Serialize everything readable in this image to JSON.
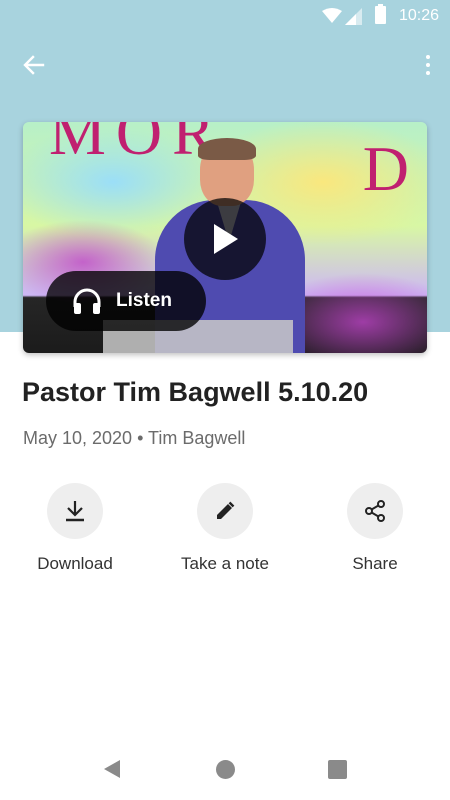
{
  "status_bar": {
    "time": "10:26",
    "icons": [
      "wifi-icon",
      "cell-signal-icon",
      "battery-icon"
    ]
  },
  "app_bar": {
    "back_icon": "arrow-back-icon",
    "menu_icon": "more-vert-icon"
  },
  "media": {
    "play_icon": "play-icon",
    "listen_label": "Listen",
    "listen_icon": "headphones-icon"
  },
  "sermon": {
    "title": "Pastor Tim Bagwell 5.10.20",
    "meta": "May 10, 2020 • Tim Bagwell"
  },
  "actions": [
    {
      "label": "Download",
      "icon": "download-icon"
    },
    {
      "label": "Take a note",
      "icon": "pencil-icon"
    },
    {
      "label": "Share",
      "icon": "share-icon"
    }
  ],
  "nav_bar": {
    "icons": [
      "nav-back-icon",
      "nav-home-icon",
      "nav-recents-icon"
    ]
  },
  "colors": {
    "header_background": "#a8d3de",
    "action_circle": "#eeeeee",
    "title_text": "#222222",
    "meta_text": "#6b6b6b"
  }
}
